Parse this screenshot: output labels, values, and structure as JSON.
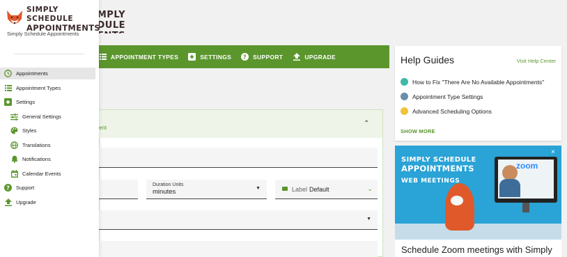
{
  "background": {
    "logo_fragment": "EDULE\nS",
    "topnav": [
      {
        "label": "APPOINTMENT TYPES",
        "icon": "list-icon"
      },
      {
        "label": "SETTINGS",
        "icon": "settings-box-icon"
      },
      {
        "label": "SUPPORT",
        "icon": "help-circle-icon"
      },
      {
        "label": "UPGRADE",
        "icon": "upload-icon"
      }
    ],
    "panel_header_text": "ent",
    "duration_units_label": "Duration Units",
    "duration_units_value": "minutes",
    "label_field_label": "Label",
    "label_field_value": "Default"
  },
  "help_guides": {
    "title": "Help Guides",
    "visit_link": "Visit Help Center",
    "items": [
      {
        "label": "How to Fix \"There Are No Available Appointments\"",
        "color": "#3fb8a6"
      },
      {
        "label": "Appointment Type Settings",
        "color": "#6b8fa8"
      },
      {
        "label": "Advanced Scheduling Options",
        "color": "#f0c33c"
      }
    ],
    "show_more": "SHOW MORE"
  },
  "promo": {
    "brand_line1": "SIMPLY SCHEDULE",
    "brand_line2": "APPOINTMENTS",
    "brand_line3": "WEB MEETINGS",
    "zoom_text": "zoom",
    "close": "×",
    "headline": "Schedule Zoom meetings with Simply"
  },
  "sidebar": {
    "brand_line1": "SIMPLY SCHEDULE",
    "brand_line2": "APPOINTMENTS",
    "subtitle": "Simply Schedule Appointments",
    "items": [
      {
        "label": "Appointments",
        "icon": "clock-icon",
        "active": true
      },
      {
        "label": "Appointment Types",
        "icon": "list-icon"
      },
      {
        "label": "Settings",
        "icon": "settings-box-icon"
      },
      {
        "label": "General Settings",
        "icon": "sliders-icon"
      },
      {
        "label": "Styles",
        "icon": "palette-icon"
      },
      {
        "label": "Translations",
        "icon": "globe-icon"
      },
      {
        "label": "Notifications",
        "icon": "bell-icon"
      },
      {
        "label": "Calendar Events",
        "icon": "calendar-icon"
      },
      {
        "label": "Support",
        "icon": "help-circle-icon"
      },
      {
        "label": "Upgrade",
        "icon": "upload-icon"
      }
    ]
  },
  "colors": {
    "accent_green": "#5b962d",
    "brand_brown": "#3b2a2a",
    "promo_blue": "#2aa3d6"
  }
}
